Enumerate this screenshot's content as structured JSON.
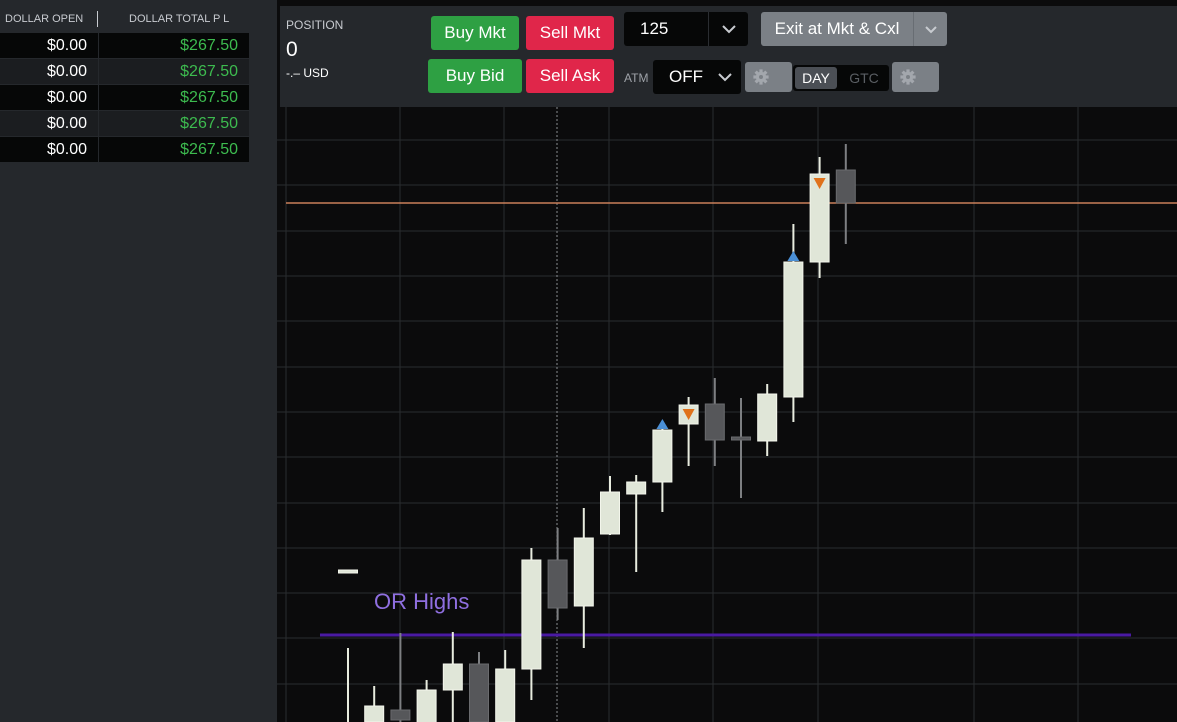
{
  "pl_panel": {
    "header": {
      "dollar_open": "DOLLAR OPEN",
      "dollar_total_pl": "DOLLAR TOTAL P L"
    },
    "rows": [
      {
        "open": "$0.00",
        "total": "$267.50"
      },
      {
        "open": "$0.00",
        "total": "$267.50"
      },
      {
        "open": "$0.00",
        "total": "$267.50"
      },
      {
        "open": "$0.00",
        "total": "$267.50"
      },
      {
        "open": "$0.00",
        "total": "$267.50"
      }
    ]
  },
  "order_bar": {
    "position_label": "POSITION",
    "position_value": "0",
    "position_usd": "-.– USD",
    "buy_mkt": "Buy Mkt",
    "sell_mkt": "Sell Mkt",
    "buy_bid": "Buy Bid",
    "sell_ask": "Sell Ask",
    "quantity": "125",
    "exit_label": "Exit at Mkt & Cxl",
    "atm_label": "ATM",
    "atm_value": "OFF",
    "tif_day": "DAY",
    "tif_gtc": "GTC"
  },
  "chart": {
    "or_highs_label": "OR Highs",
    "colors": {
      "up": "#e0e6d8",
      "down": "#56575a",
      "or_line": "#4a1aa3",
      "or_text": "#8f6fe0",
      "price_line": "#c9805a",
      "buy_marker": "#4a8fd6",
      "sell_marker": "#e0721b"
    },
    "candles": [
      {
        "o": 570,
        "c": 570,
        "h": 648,
        "l": 760,
        "dir": "up"
      },
      {
        "o": 722,
        "c": 706,
        "h": 686,
        "l": 760,
        "dir": "up"
      },
      {
        "o": 710,
        "c": 720,
        "h": 633,
        "l": 760,
        "dir": "down"
      },
      {
        "o": 725,
        "c": 690,
        "h": 680,
        "l": 760,
        "dir": "up"
      },
      {
        "o": 690,
        "c": 664,
        "h": 632,
        "l": 760,
        "dir": "up"
      },
      {
        "o": 664,
        "c": 722,
        "h": 652,
        "l": 760,
        "dir": "down"
      },
      {
        "o": 722,
        "c": 669,
        "h": 650,
        "l": 760,
        "dir": "up"
      },
      {
        "o": 669,
        "c": 560,
        "h": 548,
        "l": 700,
        "dir": "up"
      },
      {
        "o": 560,
        "c": 608,
        "h": 528,
        "l": 620,
        "dir": "down"
      },
      {
        "o": 606,
        "c": 538,
        "h": 508,
        "l": 648,
        "dir": "up"
      },
      {
        "o": 534,
        "c": 492,
        "h": 476,
        "l": 535,
        "dir": "up"
      },
      {
        "o": 494,
        "c": 482,
        "h": 475,
        "l": 572,
        "dir": "up"
      },
      {
        "o": 482,
        "c": 430,
        "h": 423,
        "l": 512,
        "dir": "up"
      },
      {
        "o": 424,
        "c": 405,
        "h": 397,
        "l": 466,
        "dir": "up"
      },
      {
        "o": 404,
        "c": 440,
        "h": 378,
        "l": 466,
        "dir": "down"
      },
      {
        "o": 440,
        "c": 437,
        "h": 398,
        "l": 498,
        "dir": "down"
      },
      {
        "o": 441,
        "c": 394,
        "h": 384,
        "l": 456,
        "dir": "up"
      },
      {
        "o": 397,
        "c": 262,
        "h": 224,
        "l": 422,
        "dir": "up"
      },
      {
        "o": 262,
        "c": 174,
        "h": 157,
        "l": 278,
        "dir": "up"
      },
      {
        "o": 170,
        "c": 203,
        "h": 144,
        "l": 244,
        "dir": "down"
      }
    ],
    "markers": [
      {
        "candle": 12,
        "kind": "buy"
      },
      {
        "candle": 13,
        "kind": "sell"
      },
      {
        "candle": 17,
        "kind": "buy"
      },
      {
        "candle": 18,
        "kind": "sell"
      }
    ]
  }
}
